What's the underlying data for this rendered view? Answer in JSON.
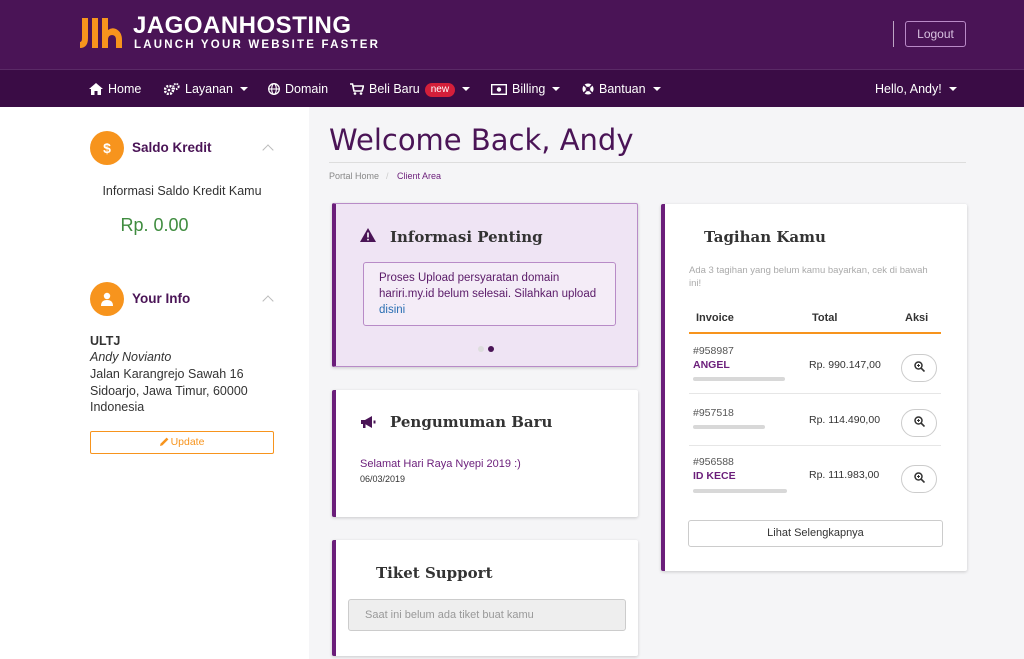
{
  "brand": {
    "name": "JAGOANHOSTING",
    "tagline": "LAUNCH YOUR WEBSITE FASTER",
    "logo_icon": "jagoan-logo-icon"
  },
  "header": {
    "logout_label": "Logout"
  },
  "nav": {
    "items": [
      {
        "label": "Home",
        "icon": "home-icon"
      },
      {
        "label": "Layanan",
        "icon": "gears-icon",
        "dropdown": true
      },
      {
        "label": "Domain",
        "icon": "globe-icon"
      },
      {
        "label": "Beli Baru",
        "icon": "cart-icon",
        "badge": "new",
        "dropdown": true
      },
      {
        "label": "Billing",
        "icon": "money-icon",
        "dropdown": true
      },
      {
        "label": "Bantuan",
        "icon": "lifebuoy-icon",
        "dropdown": true
      }
    ],
    "user_label": "Hello, Andy!"
  },
  "sidebar": {
    "saldo": {
      "title": "Saldo Kredit",
      "icon_glyph": "$",
      "desc": "Informasi Saldo Kredit Kamu",
      "value": "Rp. 0.00"
    },
    "info": {
      "title": "Your Info",
      "company": "ULTJ",
      "name": "Andy Novianto",
      "address1": "Jalan Karangrejo Sawah 16",
      "address2": "Sidoarjo, Jawa Timur, 60000",
      "country": "Indonesia",
      "update_label": "Update"
    }
  },
  "main": {
    "welcome": "Welcome Back, Andy",
    "breadcrumb": {
      "home": "Portal Home",
      "sep": "/",
      "current": "Client Area"
    },
    "info_penting": {
      "title": "Informasi Penting",
      "text": "Proses Upload persyaratan domain hariri.my.id belum selesai. Silahkan upload ",
      "link": "disini"
    },
    "pengumuman": {
      "title": "Pengumuman Baru",
      "item": "Selamat Hari Raya Nyepi 2019 :)",
      "date": "06/03/2019"
    },
    "tiket": {
      "title": "Tiket Support",
      "placeholder": "Saat ini belum ada tiket buat kamu"
    },
    "tagihan": {
      "title": "Tagihan Kamu",
      "desc": "Ada 3 tagihan yang belum kamu bayarkan, cek di bawah ini!",
      "headers": [
        "Invoice",
        "Total",
        "Aksi"
      ],
      "rows": [
        {
          "invoice": "#958987",
          "name": "ANGEL",
          "total": "Rp. 990.147,00"
        },
        {
          "invoice": "#957518",
          "name": "",
          "total": "Rp. 114.490,00"
        },
        {
          "invoice": "#956588",
          "name": "ID KECE",
          "total": "Rp. 111.983,00"
        }
      ],
      "more_label": "Lihat Selengkapnya"
    }
  },
  "colors": {
    "brand_purple": "#4a1456",
    "nav_purple": "#3a0c45",
    "accent_orange": "#f7941d",
    "saldo_green": "#3f8c3f",
    "badge_red": "#d41f3a"
  }
}
